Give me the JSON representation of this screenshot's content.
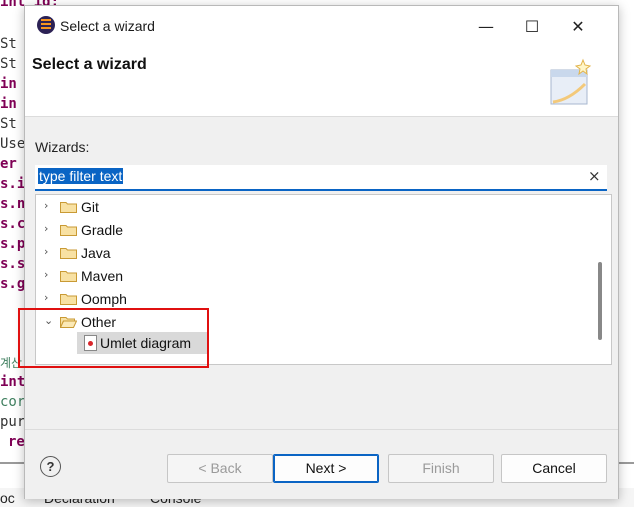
{
  "background_editor": {
    "lines": [
      "int id;",
      "St",
      "St",
      "in",
      "in",
      "St",
      "Use",
      "er",
      "s.i",
      "s.n",
      "s.c",
      "s.p",
      "s.s",
      "s.g",
      "계산",
      "int",
      "cor",
      "pur",
      "re"
    ],
    "bottom_tabs": [
      "oc",
      "Declaration",
      "Console"
    ]
  },
  "dialog": {
    "title": "Select a wizard",
    "banner_title": "Select a wizard",
    "wizards_label": "Wizards:",
    "filter": {
      "value": "type filter text",
      "clear_icon": "×"
    },
    "tree_items": [
      {
        "label": "Git",
        "expanded": false
      },
      {
        "label": "Gradle",
        "expanded": false
      },
      {
        "label": "Java",
        "expanded": false
      },
      {
        "label": "Maven",
        "expanded": false
      },
      {
        "label": "Oomph",
        "expanded": false
      },
      {
        "label": "Other",
        "expanded": true
      }
    ],
    "child_item": {
      "label": "Umlet diagram",
      "selected": true
    },
    "buttons": {
      "back": "< Back",
      "next": "Next >",
      "finish": "Finish",
      "cancel": "Cancel"
    },
    "help_icon": "?",
    "window_controls": {
      "minimize": "—",
      "maximize": "☐",
      "close": "✕"
    }
  },
  "colors": {
    "accent": "#0a64c4",
    "highlight_box": "#e01010"
  }
}
